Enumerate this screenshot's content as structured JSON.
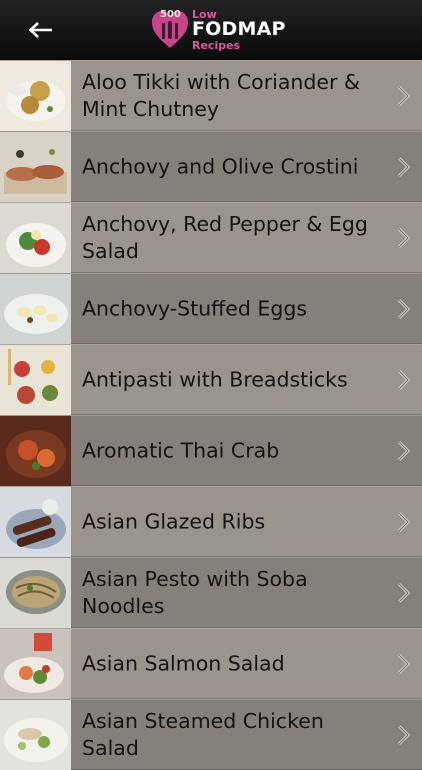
{
  "header": {
    "back_icon": "back-arrow-icon",
    "logo_number": "500",
    "logo_low": "Low",
    "logo_brand": "FODMAP",
    "logo_sub": "Recipes",
    "accent": "#d95a9e"
  },
  "recipes": [
    {
      "title": "Aloo Tikki with Coriander & Mint Chutney"
    },
    {
      "title": "Anchovy and Olive Crostini"
    },
    {
      "title": "Anchovy, Red Pepper & Egg Salad"
    },
    {
      "title": "Anchovy-Stuffed Eggs"
    },
    {
      "title": "Antipasti with Breadsticks"
    },
    {
      "title": "Aromatic Thai Crab"
    },
    {
      "title": "Asian Glazed Ribs"
    },
    {
      "title": "Asian Pesto with Soba Noodles"
    },
    {
      "title": "Asian Salmon Salad"
    },
    {
      "title": "Asian Steamed Chicken Salad"
    }
  ]
}
